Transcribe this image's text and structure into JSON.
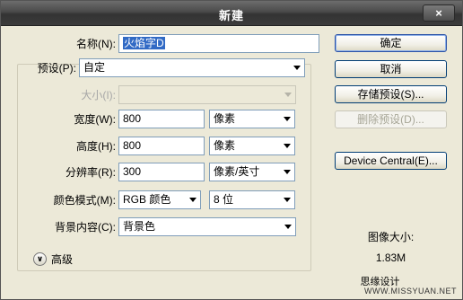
{
  "window": {
    "title": "新建",
    "close_label": "×"
  },
  "form": {
    "name": {
      "label": "名称(N):",
      "value": "火焰字D"
    },
    "preset": {
      "label": "预设(P):",
      "value": "自定"
    },
    "size": {
      "label": "大小(I):",
      "value": ""
    },
    "width": {
      "label": "宽度(W):",
      "value": "800",
      "unit": "像素"
    },
    "height": {
      "label": "高度(H):",
      "value": "800",
      "unit": "像素"
    },
    "resolution": {
      "label": "分辨率(R):",
      "value": "300",
      "unit": "像素/英寸"
    },
    "color_mode": {
      "label": "颜色模式(M):",
      "value": "RGB 颜色",
      "depth": "8 位"
    },
    "background": {
      "label": "背景内容(C):",
      "value": "背景色"
    },
    "advanced_label": "高级"
  },
  "buttons": {
    "ok": "确定",
    "cancel": "取消",
    "save_preset": "存储预设(S)...",
    "delete_preset": "删除预设(D)...",
    "device_central": "Device Central(E)..."
  },
  "info": {
    "image_size_label": "图像大小:",
    "image_size_value": "1.83M"
  },
  "watermark": {
    "brand": "思缘设计",
    "url": "WWW.MISSYUAN.NET"
  }
}
